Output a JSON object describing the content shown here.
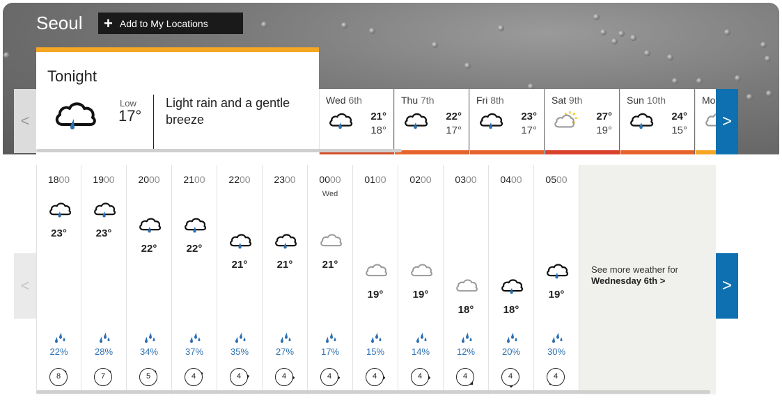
{
  "header": {
    "city": "Seoul",
    "add_button_label": "Add to My Locations"
  },
  "tonight": {
    "title": "Tonight",
    "low_label": "Low",
    "low_temp": "17°",
    "description": "Light rain and a gentle breeze",
    "icon": "light-rain-cloud-icon"
  },
  "days": [
    {
      "name": "Wed",
      "num": "6th",
      "high": "21°",
      "low": "18°",
      "icon": "light-rain-cloud-icon",
      "bar_color": "#d2502b"
    },
    {
      "name": "Thu",
      "num": "7th",
      "high": "22°",
      "low": "17°",
      "icon": "light-rain-cloud-icon",
      "bar_color": "#e8632b"
    },
    {
      "name": "Fri",
      "num": "8th",
      "high": "23°",
      "low": "17°",
      "icon": "light-rain-cloud-icon",
      "bar_color": "#e8632b"
    },
    {
      "name": "Sat",
      "num": "9th",
      "high": "27°",
      "low": "19°",
      "icon": "sunny-intervals-icon",
      "bar_color": "#d9412c"
    },
    {
      "name": "Sun",
      "num": "10th",
      "high": "24°",
      "low": "15°",
      "icon": "light-rain-cloud-icon",
      "bar_color": "#e8632b"
    },
    {
      "name": "Mo",
      "num": "",
      "high": "",
      "low": "",
      "icon": "cloud-icon",
      "bar_color": "#f5a623"
    }
  ],
  "hours": [
    {
      "hour": "18",
      "mins": "00",
      "day": "",
      "icon": "rain",
      "temp": "23°",
      "rain": "22%",
      "wind": "8",
      "dir": 45
    },
    {
      "hour": "19",
      "mins": "00",
      "day": "",
      "icon": "rain",
      "temp": "23°",
      "rain": "28%",
      "wind": "7",
      "dir": 45
    },
    {
      "hour": "20",
      "mins": "00",
      "day": "",
      "icon": "rain",
      "temp": "22°",
      "rain": "34%",
      "wind": "5",
      "dir": 45
    },
    {
      "hour": "21",
      "mins": "00",
      "day": "",
      "icon": "rain",
      "temp": "22°",
      "rain": "37%",
      "wind": "4",
      "dir": 60
    },
    {
      "hour": "22",
      "mins": "00",
      "day": "",
      "icon": "rain",
      "temp": "21°",
      "rain": "35%",
      "wind": "4",
      "dir": 80
    },
    {
      "hour": "23",
      "mins": "00",
      "day": "",
      "icon": "rain",
      "temp": "21°",
      "rain": "27%",
      "wind": "4",
      "dir": 90
    },
    {
      "hour": "00",
      "mins": "00",
      "day": "Wed",
      "icon": "cloud",
      "temp": "21°",
      "rain": "17%",
      "wind": "4",
      "dir": 90
    },
    {
      "hour": "01",
      "mins": "00",
      "day": "",
      "icon": "cloud",
      "temp": "19°",
      "rain": "15%",
      "wind": "4",
      "dir": 90
    },
    {
      "hour": "02",
      "mins": "00",
      "day": "",
      "icon": "cloud",
      "temp": "19°",
      "rain": "14%",
      "wind": "4",
      "dir": 90
    },
    {
      "hour": "03",
      "mins": "00",
      "day": "",
      "icon": "cloud",
      "temp": "18°",
      "rain": "12%",
      "wind": "4",
      "dir": 135
    },
    {
      "hour": "04",
      "mins": "00",
      "day": "",
      "icon": "rain",
      "temp": "18°",
      "rain": "20%",
      "wind": "4",
      "dir": 180
    },
    {
      "hour": "05",
      "mins": "00",
      "day": "",
      "icon": "rain",
      "temp": "19°",
      "rain": "30%",
      "wind": "4",
      "dir": 225
    }
  ],
  "see_more": {
    "line1": "See more weather for",
    "line2": "Wednesday 6th",
    "chevron": ">"
  },
  "nav": {
    "prev": "<",
    "next": ">"
  },
  "colors": {
    "accent_blue": "#0e70b0",
    "rain_blue": "#2d6fb1",
    "tonight_bar": "#f5a623"
  }
}
